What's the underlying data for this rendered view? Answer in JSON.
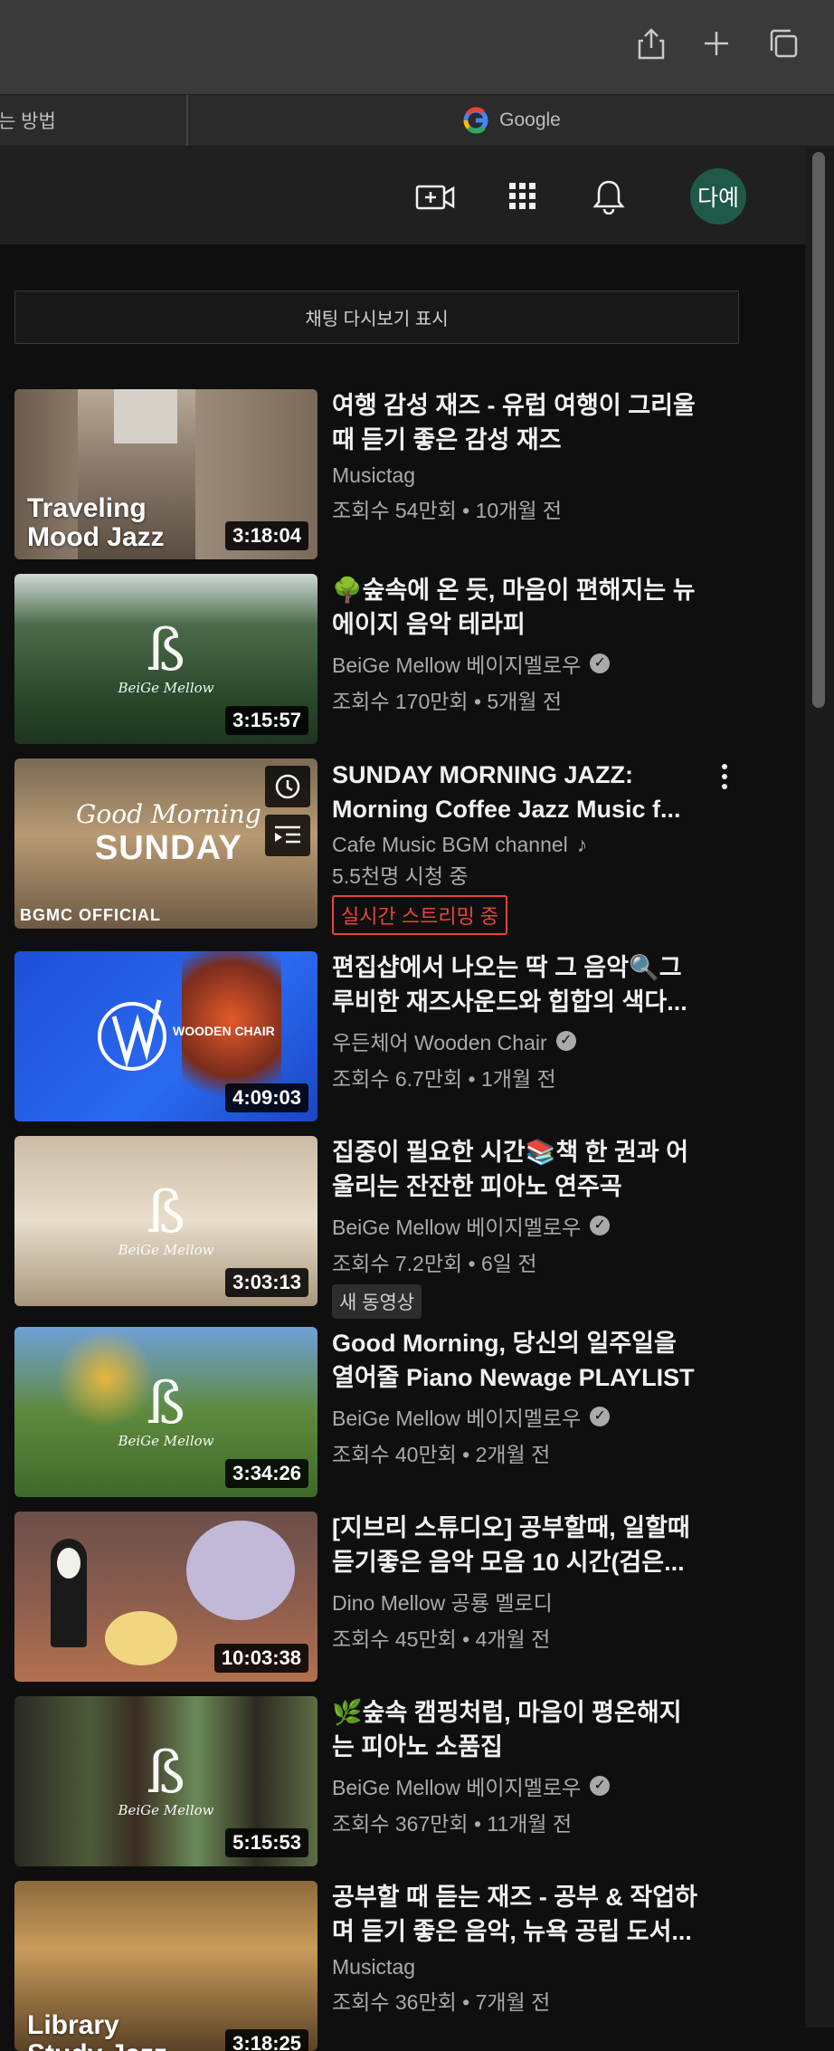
{
  "browser": {
    "tab_left_label": "는 방법",
    "tab_right_label": "Google"
  },
  "header": {
    "avatar_label": "다예"
  },
  "chat_replay_label": "채팅 다시보기 표시",
  "videos": [
    {
      "title_line1": "여행 감성 재즈 - 유럽 여행이 그리울",
      "title_line2": "때 듣기 좋은 감성 재즈",
      "channel": "Musictag",
      "stats": "조회수 54만회 • 10개월 전",
      "duration": "3:18:04",
      "thumb_text_1": "Traveling",
      "thumb_text_2": "Mood Jazz"
    },
    {
      "title_line1": "🌳숲속에 온 듯, 마음이 편해지는 뉴",
      "title_line2": "에이지 음악 테라피",
      "channel": "BeiGe Mellow 베이지멜로우",
      "stats": "조회수 170만회 • 5개월 전",
      "duration": "3:15:57",
      "thumb_brand": "BeiGe Mellow"
    },
    {
      "title_line1": "SUNDAY MORNING JAZZ:",
      "title_line2": "Morning Coffee Jazz Music f...",
      "channel": "Cafe Music BGM channel",
      "stats": "5.5천명 시청 중",
      "live_badge": "실시간 스트리밍 중",
      "thumb_text_1": "Good Morning",
      "thumb_text_2": "SUNDAY",
      "thumb_brand": "BGMC OFFICIAL"
    },
    {
      "title_line1": "편집샵에서 나오는 딱 그 음악🔍그",
      "title_line2": "루비한 재즈사운드와 힙합의 색다...",
      "channel": "우든체어 Wooden Chair",
      "stats": "조회수 6.7만회 • 1개월 전",
      "duration": "4:09:03",
      "thumb_brand": "WOODEN CHAIR"
    },
    {
      "title_line1": "집중이 필요한 시간📚책 한 권과 어",
      "title_line2": "울리는 잔잔한 피아노 연주곡",
      "channel": "BeiGe Mellow 베이지멜로우",
      "stats": "조회수 7.2만회 • 6일 전",
      "new_badge": "새 동영상",
      "duration": "3:03:13",
      "thumb_brand": "BeiGe Mellow"
    },
    {
      "title_line1": "Good Morning, 당신의 일주일을",
      "title_line2": "열어줄 Piano Newage PLAYLIST",
      "channel": "BeiGe Mellow 베이지멜로우",
      "stats": "조회수 40만회 • 2개월 전",
      "duration": "3:34:26",
      "thumb_brand": "BeiGe Mellow"
    },
    {
      "title_line1": "[지브리 스튜디오] 공부할때, 일할때",
      "title_line2": "듣기좋은 음악 모음 10 시간(검은...",
      "channel": "Dino Mellow 공룡 멜로디",
      "stats": "조회수 45만회 • 4개월 전",
      "duration": "10:03:38"
    },
    {
      "title_line1": "🌿숲속 캠핑처럼, 마음이 평온해지",
      "title_line2": "는 피아노 소품집",
      "channel": "BeiGe Mellow 베이지멜로우",
      "stats": "조회수 367만회 • 11개월 전",
      "duration": "5:15:53",
      "thumb_brand": "BeiGe Mellow"
    },
    {
      "title_line1": "공부할 때 듣는 재즈 - 공부 & 작업하",
      "title_line2": "며 듣기 좋은 음악, 뉴욕 공립 도서...",
      "channel": "Musictag",
      "stats": "조회수 36만회 • 7개월 전",
      "duration": "3:18:25",
      "thumb_text_1": "Library",
      "thumb_text_2": "Study Jazz"
    }
  ]
}
